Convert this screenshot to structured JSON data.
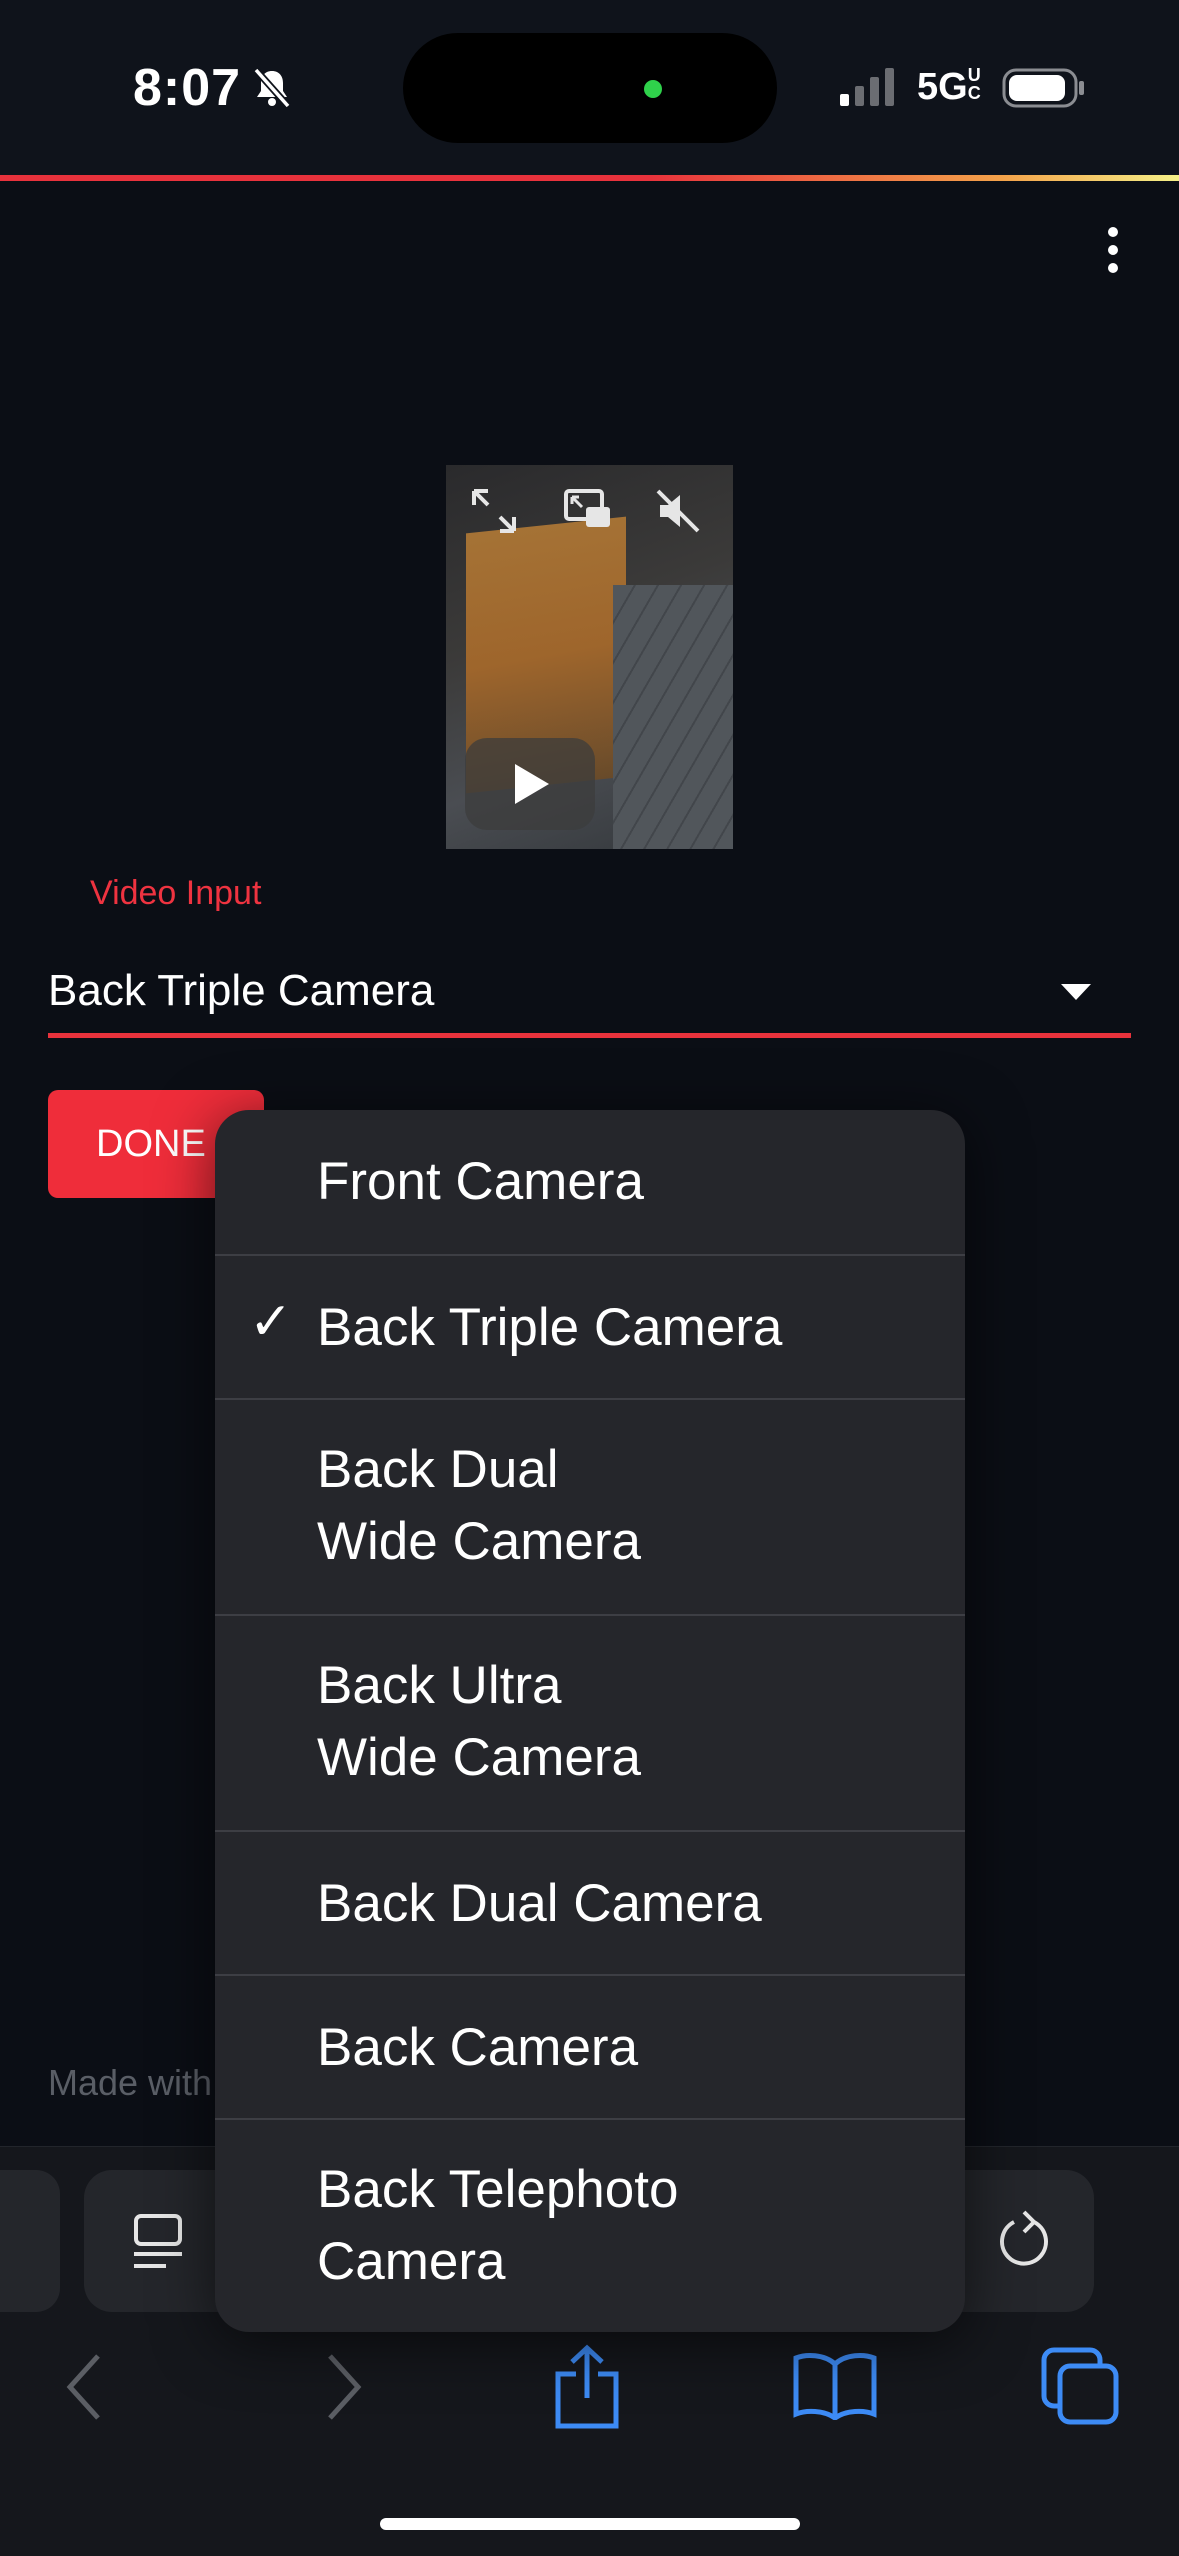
{
  "status_bar": {
    "time": "8:07",
    "network": "5G",
    "network_sup": "UC"
  },
  "form": {
    "field_label": "Video Input",
    "selected_value": "Back Triple Camera",
    "done_label": "DONE"
  },
  "footer": {
    "text": "Made with"
  },
  "menu": {
    "items": [
      {
        "label": "Front Camera",
        "checked": false
      },
      {
        "label": "Back Triple Camera",
        "checked": true
      },
      {
        "label": "Back Dual\nWide Camera",
        "checked": false
      },
      {
        "label": "Back Ultra\nWide Camera",
        "checked": false
      },
      {
        "label": "Back Dual Camera",
        "checked": false
      },
      {
        "label": "Back Camera",
        "checked": false
      },
      {
        "label": "Back Telephoto\nCamera",
        "checked": false
      }
    ],
    "check_glyph": "✓"
  },
  "colors": {
    "accent": "#ef2d3a",
    "background": "#0b0e15",
    "menu_bg": "#25262b",
    "safari_blue": "#3d8bf5"
  }
}
